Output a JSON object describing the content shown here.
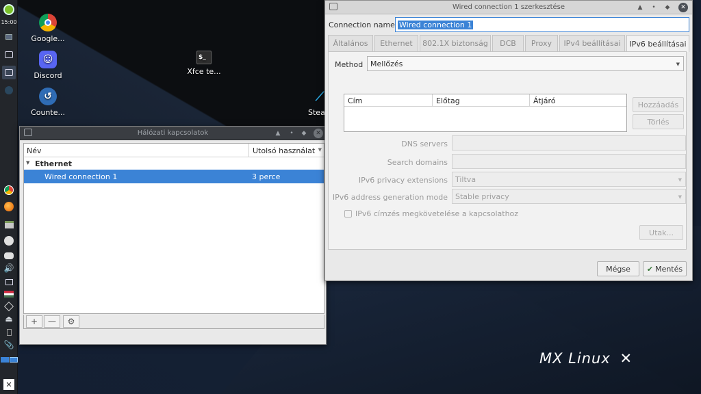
{
  "panel": {
    "clock": "15:00"
  },
  "desktop": {
    "icons": [
      {
        "label": "Google..."
      },
      {
        "label": "Discord"
      },
      {
        "label": "Counte..."
      },
      {
        "label": "Xfce te..."
      },
      {
        "label": "Stea"
      }
    ],
    "brand": "MX Linux"
  },
  "netwin": {
    "title": "Hálózati kapcsolatok",
    "columns": {
      "name": "Név",
      "last_used": "Utolsó használat"
    },
    "group": "Ethernet",
    "rows": [
      {
        "name": "Wired connection 1",
        "last_used": "3 perce"
      }
    ]
  },
  "editor": {
    "title": "Wired connection 1 szerkesztése",
    "connection_name_label": "Connection name",
    "connection_name_value": "Wired connection 1",
    "tabs": [
      "Általános",
      "Ethernet",
      "802.1X biztonság",
      "DCB",
      "Proxy",
      "IPv4 beállításai",
      "IPv6 beállításai"
    ],
    "method_label": "Method",
    "method_value": "Mellőzés",
    "address_columns": [
      "Cím",
      "Előtag",
      "Átjáró"
    ],
    "add_button": "Hozzáadás",
    "delete_button": "Törlés",
    "dns_label": "DNS servers",
    "search_domains_label": "Search domains",
    "privacy_label": "IPv6 privacy extensions",
    "privacy_value": "Tiltva",
    "addr_gen_label": "IPv6 address generation mode",
    "addr_gen_value": "Stable privacy",
    "require_ipv6_label": "IPv6 címzés megkövetelése a kapcsolathoz",
    "routes_button": "Utak...",
    "cancel_button": "Mégse",
    "save_button": "Mentés"
  }
}
